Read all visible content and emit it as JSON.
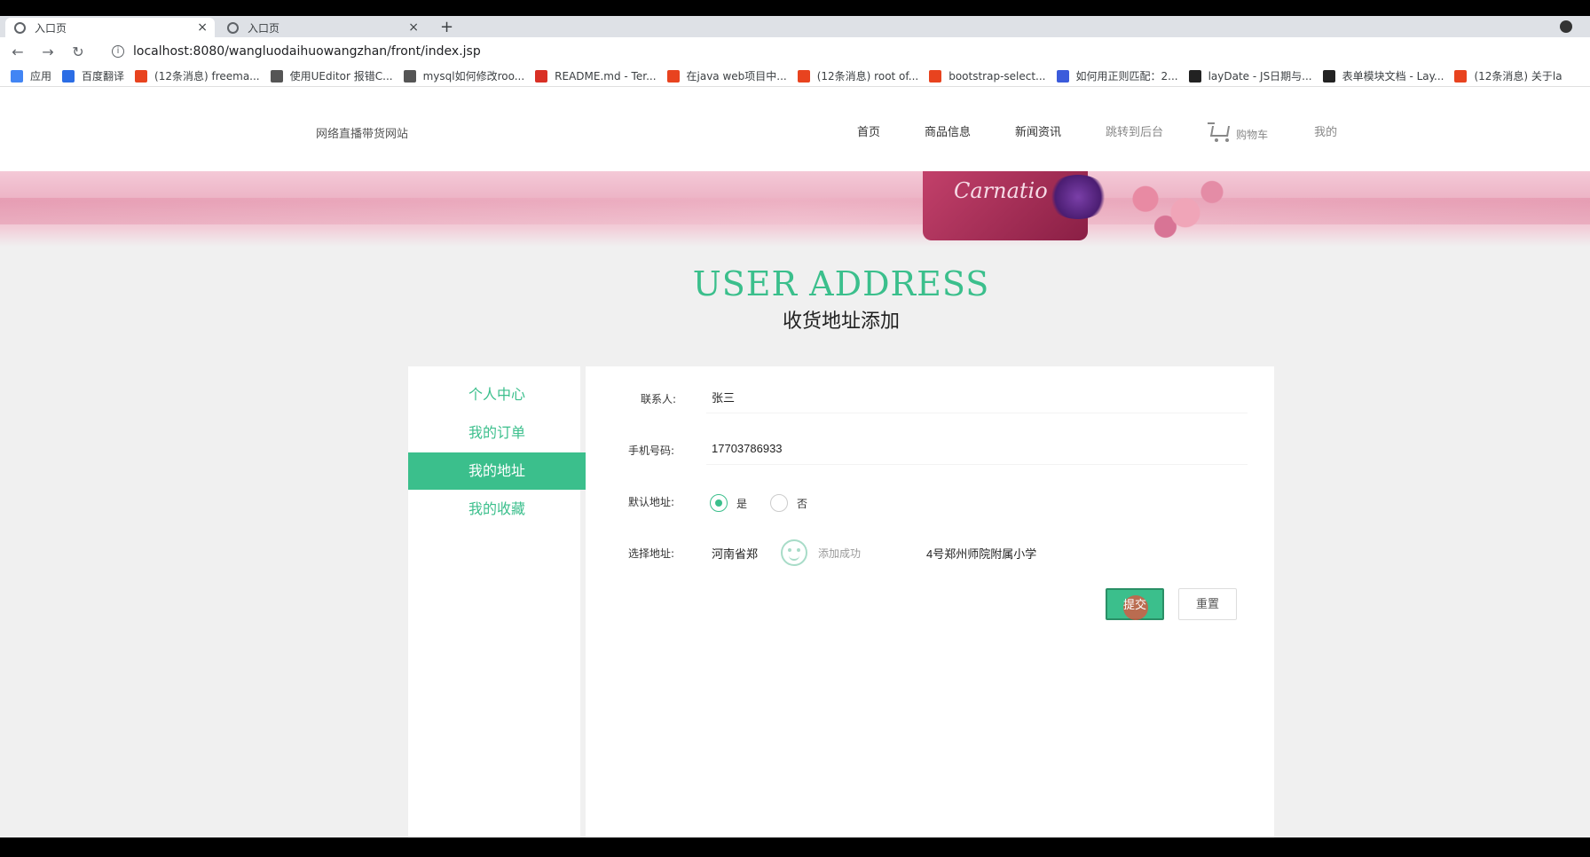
{
  "browser": {
    "tabs": [
      {
        "label": "入口页",
        "active": true
      },
      {
        "label": "入口页",
        "active": false
      }
    ],
    "new_tab": "+",
    "url": "localhost:8080/wangluodaihuowangzhan/front/index.jsp",
    "bookmarks": [
      {
        "label": "应用",
        "color": "#4285f4"
      },
      {
        "label": "百度翻译",
        "color": "#2b6de5"
      },
      {
        "label": "(12条消息) freema...",
        "color": "#e8431f"
      },
      {
        "label": "使用UEditor 报错C...",
        "color": "#555555"
      },
      {
        "label": "mysql如何修改roo...",
        "color": "#555555"
      },
      {
        "label": "README.md - Ter...",
        "color": "#d93025"
      },
      {
        "label": "在java web项目中...",
        "color": "#e8431f"
      },
      {
        "label": "(12条消息) root of...",
        "color": "#e8431f"
      },
      {
        "label": "bootstrap-select...",
        "color": "#e8431f"
      },
      {
        "label": "如何用正则匹配：2...",
        "color": "#3b5bdb"
      },
      {
        "label": "layDate - JS日期与...",
        "color": "#222222"
      },
      {
        "label": "表单模块文档 - Lay...",
        "color": "#222222"
      },
      {
        "label": "(12条消息) 关于la",
        "color": "#e8431f"
      }
    ]
  },
  "site": {
    "title": "网络直播带货网站",
    "nav": [
      "首页",
      "商品信息",
      "新闻资讯",
      "跳转到后台"
    ],
    "cart_label": "购物车",
    "mine_label": "我的"
  },
  "banner": {
    "product_text": "Carnatio"
  },
  "heading": {
    "en": "USER ADDRESS",
    "cn": "收货地址添加"
  },
  "sidemenu": {
    "items": [
      {
        "label": "个人中心",
        "active": false
      },
      {
        "label": "我的订单",
        "active": false
      },
      {
        "label": "我的地址",
        "active": true
      },
      {
        "label": "我的收藏",
        "active": false
      }
    ]
  },
  "form": {
    "contact_label": "联系人:",
    "contact_value": "张三",
    "phone_label": "手机号码:",
    "phone_value": "17703786933",
    "default_label": "默认地址:",
    "default_yes": "是",
    "default_no": "否",
    "default_selected": "是",
    "address_label": "选择地址:",
    "address_value_left": "河南省郑",
    "address_value_right": "4号郑州师院附属小学",
    "toast_text": "添加成功",
    "submit_label": "提交",
    "reset_label": "重置"
  },
  "colors": {
    "accent": "#3bbf8c"
  }
}
